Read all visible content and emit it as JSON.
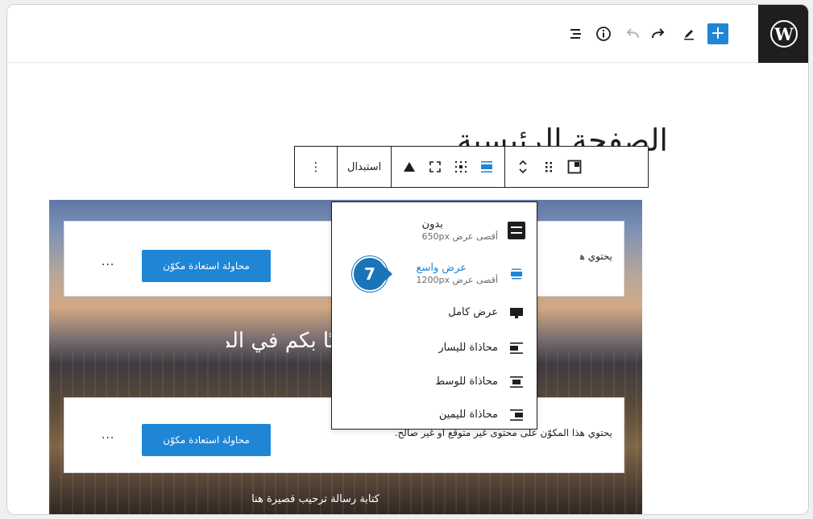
{
  "topbar": {
    "logo_glyph": "W",
    "add_icon": "+",
    "colors": {
      "accent": "#1f86d6",
      "logo_bg": "#1e1e1e"
    }
  },
  "page": {
    "title": "الصفحة الرئيسية",
    "hero_heading": "مرحبًا بكم في المتجر",
    "hero_subtitle": "كتابة رسالة ترحيب قصيرة هنا"
  },
  "block_toolbar": {
    "replace_label": "استبدال",
    "more_glyph": "⋮"
  },
  "cards": [
    {
      "text": "يحتوي هذا المكوّن على محتوى غير متوقع أو غير صالح.",
      "button": "محاولة استعادة مكوّن",
      "more": "···"
    },
    {
      "text": "يحتوي هذا المكوّن على محتوى غير متوقع أو غير صالح.",
      "button": "محاولة استعادة مكوّن",
      "more": "···"
    }
  ],
  "align_menu": {
    "items": [
      {
        "label": "بدون",
        "sub": "أقصى عرض 650px",
        "icon": "align-none-icon"
      },
      {
        "label": "عرض واسع",
        "sub": "أقصى عرض 1200px",
        "icon": "align-wide-icon",
        "active": true
      },
      {
        "label": "عرض كامل",
        "sub": "",
        "icon": "align-full-icon"
      },
      {
        "label": "محاذاة لليسار",
        "sub": "",
        "icon": "align-left-icon"
      },
      {
        "label": "محاذاة للوسط",
        "sub": "",
        "icon": "align-center-icon"
      },
      {
        "label": "محاذاة لليمين",
        "sub": "",
        "icon": "align-right-icon"
      }
    ]
  },
  "step_badge": "7"
}
